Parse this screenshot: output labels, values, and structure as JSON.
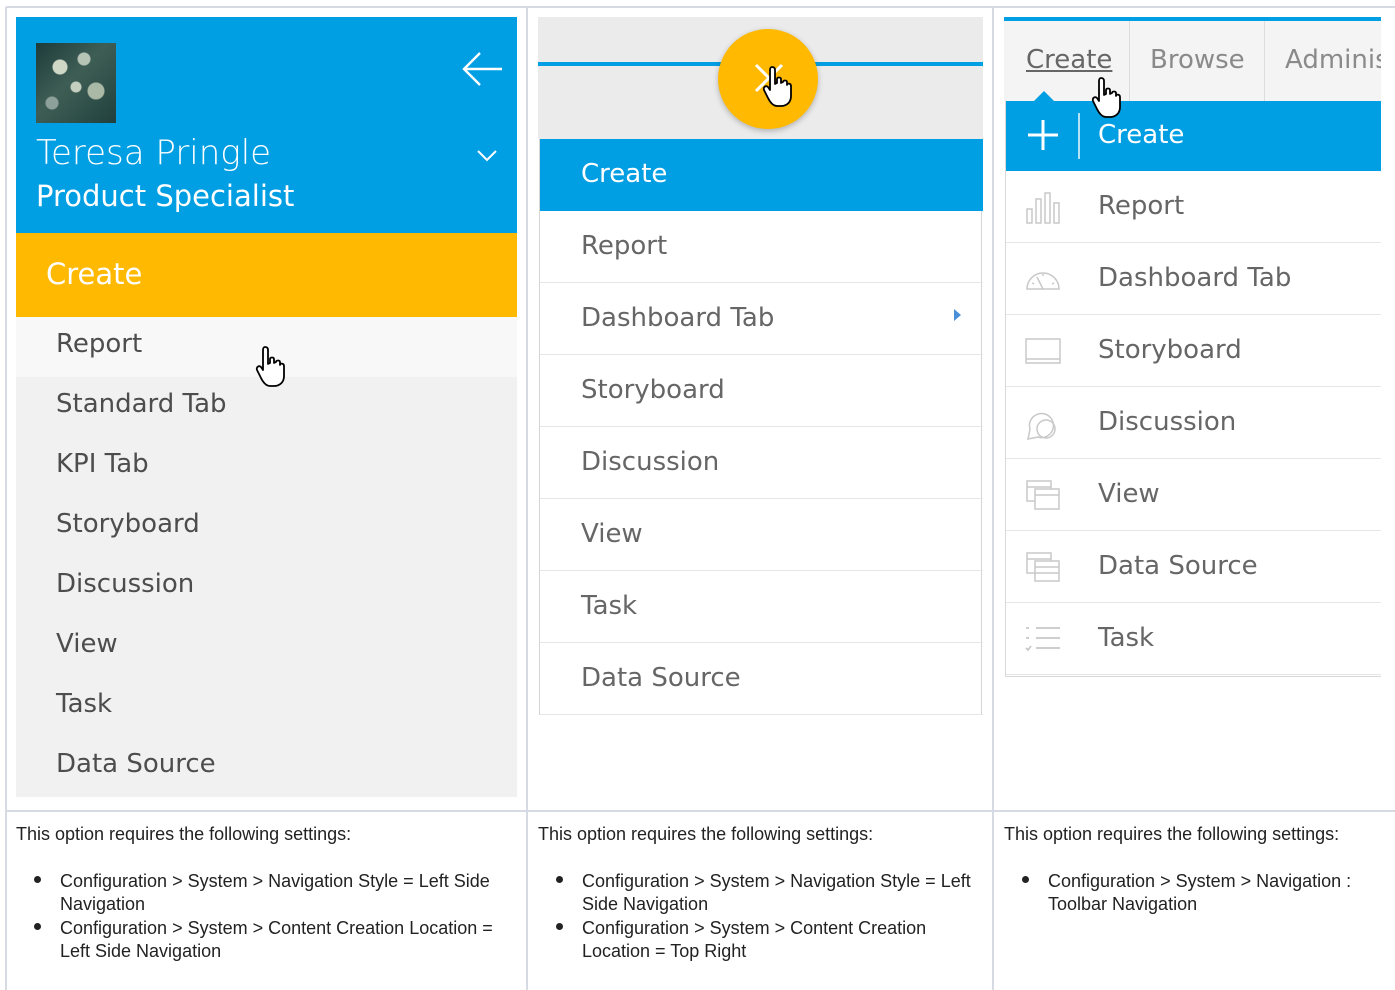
{
  "colors": {
    "blue": "#009ee2",
    "amber": "#ffb900",
    "text": "#666666",
    "grid": "#d6dbe3"
  },
  "panel1": {
    "user_name": "Teresa Pringle",
    "user_role": "Product Specialist",
    "create_label": "Create",
    "items": [
      "Report",
      "Standard Tab",
      "KPI Tab",
      "Storyboard",
      "Discussion",
      "View",
      "Task",
      "Data Source"
    ],
    "caption": "This option requires the following settings:",
    "bullets": [
      "Configuration > System > Navigation Style = Left Side Navigation",
      "Configuration > System > Content Creation Location = Left Side Navigation"
    ]
  },
  "panel2": {
    "create_label": "Create",
    "items": [
      "Report",
      "Dashboard Tab",
      "Storyboard",
      "Discussion",
      "View",
      "Task",
      "Data Source"
    ],
    "caption": "This option requires the following settings:",
    "bullets": [
      "Configuration > System > Navigation Style = Left Side Navigation",
      "Configuration > System > Content Creation Location = Top Right"
    ]
  },
  "panel3": {
    "tabs": [
      "Create",
      "Browse",
      "Adminis"
    ],
    "dropdown_title": "Create",
    "items": [
      {
        "label": "Report",
        "icon": "bar-chart-icon"
      },
      {
        "label": "Dashboard Tab",
        "icon": "gauge-icon"
      },
      {
        "label": "Storyboard",
        "icon": "monitor-icon"
      },
      {
        "label": "Discussion",
        "icon": "chat-bubble-icon"
      },
      {
        "label": "View",
        "icon": "view-layers-icon"
      },
      {
        "label": "Data Source",
        "icon": "data-source-icon"
      },
      {
        "label": "Task",
        "icon": "checklist-icon"
      }
    ],
    "caption": "This option requires the following settings:",
    "bullets": [
      "Configuration > System > Navigation : Toolbar Navigation"
    ]
  }
}
